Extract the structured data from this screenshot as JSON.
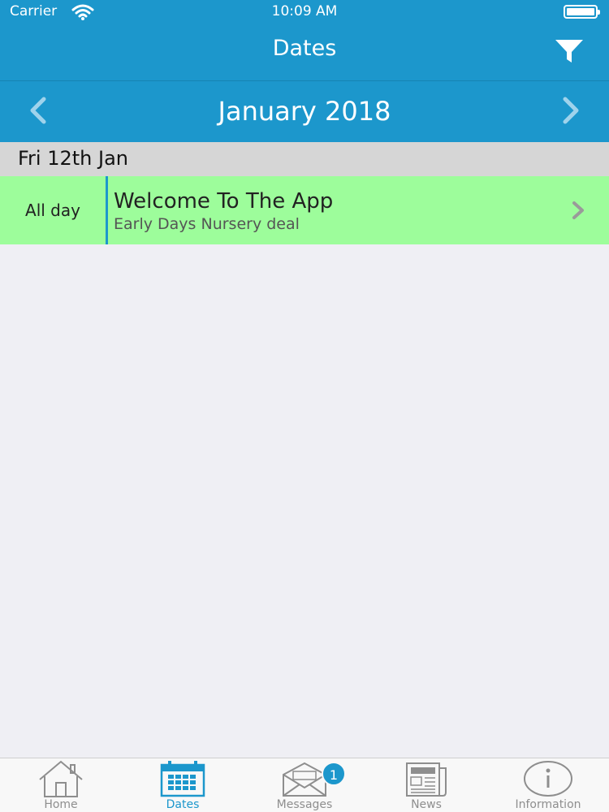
{
  "status_bar": {
    "carrier": "Carrier",
    "time": "10:09 AM"
  },
  "nav": {
    "title": "Dates",
    "filter_icon": "filter-icon"
  },
  "month_nav": {
    "title": "January 2018",
    "prev_icon": "chevron-left-icon",
    "next_icon": "chevron-right-icon"
  },
  "sections": [
    {
      "header": "Fri 12th Jan",
      "events": [
        {
          "time": "All day",
          "title": "Welcome To The App",
          "subtitle": "Early Days Nursery deal"
        }
      ]
    }
  ],
  "tabs": [
    {
      "label": "Home",
      "icon": "home-icon",
      "active": false
    },
    {
      "label": "Dates",
      "icon": "calendar-icon",
      "active": true
    },
    {
      "label": "Messages",
      "icon": "envelope-icon",
      "active": false,
      "badge": "1"
    },
    {
      "label": "News",
      "icon": "newspaper-icon",
      "active": false
    },
    {
      "label": "Information",
      "icon": "info-icon",
      "active": false
    }
  ],
  "colors": {
    "header_blue": "#1c97cc",
    "event_green": "#9dfd9b",
    "section_gray": "#d6d6d6",
    "background": "#efeff4"
  }
}
